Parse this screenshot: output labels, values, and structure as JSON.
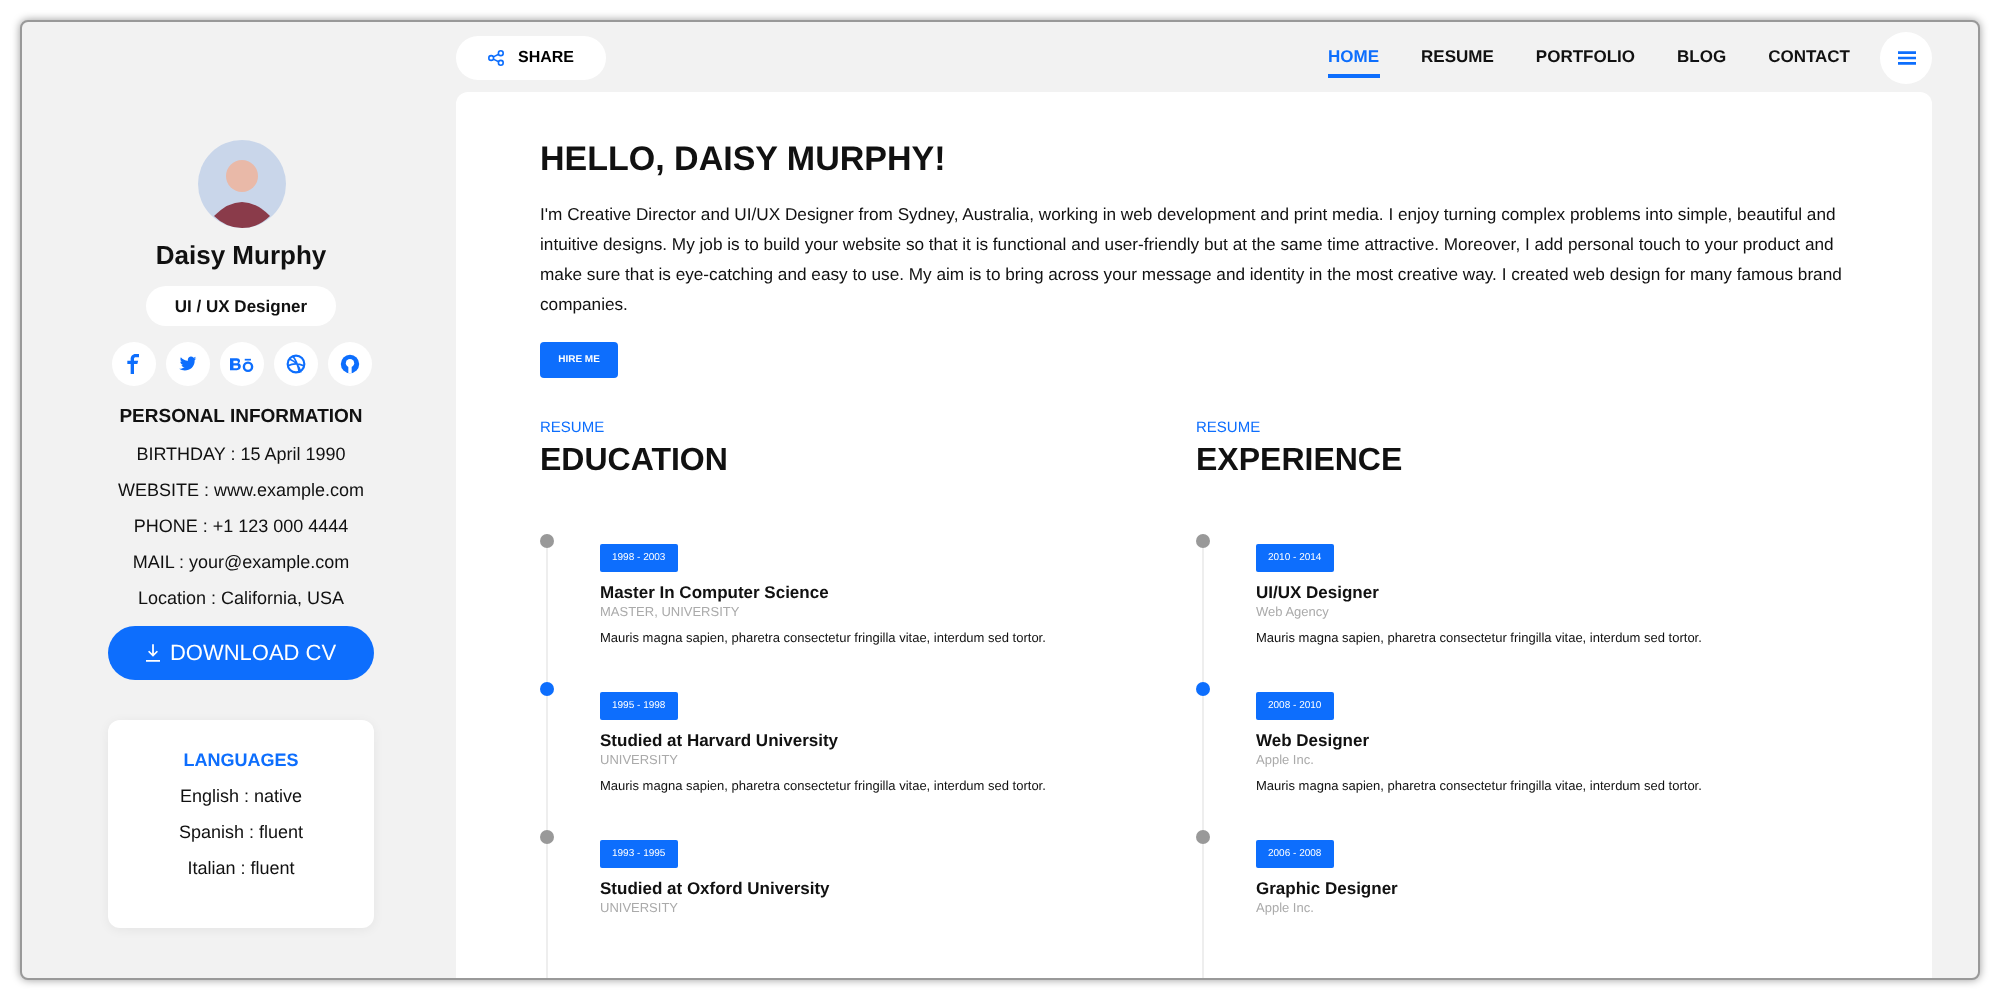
{
  "profile": {
    "name": "Daisy Murphy",
    "role": "UI / UX Designer",
    "social": [
      {
        "kind": "facebook"
      },
      {
        "kind": "twitter"
      },
      {
        "kind": "behance"
      },
      {
        "kind": "dribbble"
      },
      {
        "kind": "github"
      }
    ]
  },
  "personal": {
    "title": "PERSONAL INFORMATION",
    "lines": [
      "BIRTHDAY : 15 April 1990",
      "WEBSITE : www.example.com",
      "PHONE : +1 123 000 4444",
      "MAIL : your@example.com",
      "Location : California, USA"
    ]
  },
  "download_button": "DOWNLOAD CV",
  "languages": {
    "title": "LANGUAGES",
    "items": [
      "English : native",
      "Spanish : fluent",
      "Italian : fluent"
    ]
  },
  "share_button": "SHARE",
  "nav": [
    {
      "label": "HOME",
      "selected": true
    },
    {
      "label": "RESUME",
      "selected": false
    },
    {
      "label": "PORTFOLIO",
      "selected": false
    },
    {
      "label": "BLOG",
      "selected": false
    },
    {
      "label": "CONTACT",
      "selected": false
    }
  ],
  "hero": {
    "title": "HELLO, DAISY MURPHY!",
    "text": "I'm Creative Director and UI/UX Designer from Sydney, Australia, working in web development and print media. I enjoy turning complex problems into simple, beautiful and intuitive designs. My job is to build your website so that it is functional and user-friendly but at the same time attractive. Moreover, I add personal touch to your product and make sure that is eye-catching and easy to use. My aim is to bring across your message and identity in the most creative way. I created web design for many famous brand companies.",
    "button": "HIRE ME"
  },
  "sections": [
    {
      "eyebrow": "RESUME",
      "title": "EDUCATION",
      "items": [
        {
          "date": "1998 - 2003",
          "title": "Master In Computer Science",
          "subtitle": "MASTER, UNIVERSITY",
          "text": "Mauris magna sapien, pharetra consectetur fringilla vitae, interdum sed tortor.",
          "active": false
        },
        {
          "date": "1995 - 1998",
          "title": "Studied at Harvard University",
          "subtitle": "UNIVERSITY",
          "text": "Mauris magna sapien, pharetra consectetur fringilla vitae, interdum sed tortor.",
          "active": true
        },
        {
          "date": "1993 - 1995",
          "title": "Studied at Oxford University",
          "subtitle": "UNIVERSITY",
          "active": false
        }
      ]
    },
    {
      "eyebrow": "RESUME",
      "title": "EXPERIENCE",
      "items": [
        {
          "date": "2010 - 2014",
          "title": "UI/UX Designer",
          "subtitle": "Web Agency",
          "text": "Mauris magna sapien, pharetra consectetur fringilla vitae, interdum sed tortor.",
          "active": false
        },
        {
          "date": "2008 - 2010",
          "title": "Web Designer",
          "subtitle": "Apple Inc.",
          "text": "Mauris magna sapien, pharetra consectetur fringilla vitae, interdum sed tortor.",
          "active": true
        },
        {
          "date": "2006 - 2008",
          "title": "Graphic Designer",
          "subtitle": "Apple Inc.",
          "active": false
        }
      ]
    }
  ]
}
